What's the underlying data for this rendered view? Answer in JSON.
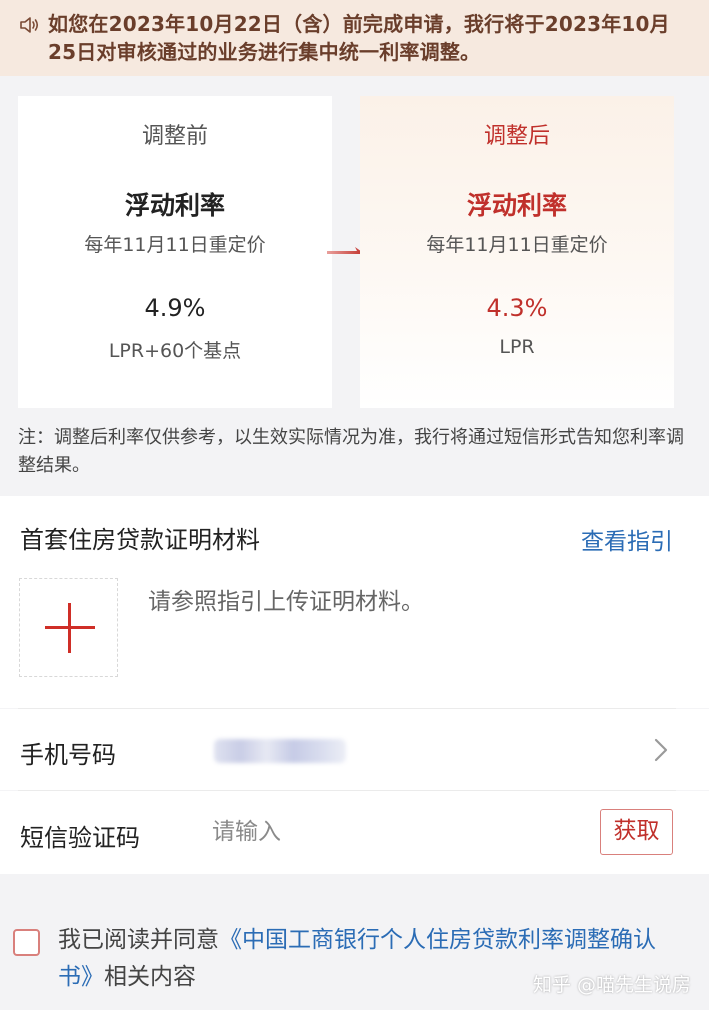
{
  "notice": {
    "text": "如您在2023年10月22日（含）前完成申请，我行将于2023年10月25日对审核通过的业务进行集中统一利率调整。"
  },
  "compare": {
    "before": {
      "head": "调整前",
      "type": "浮动利率",
      "reprice": "每年11月11日重定价",
      "rate": "4.9%",
      "basis": "LPR+60个基点"
    },
    "after": {
      "head": "调整后",
      "type": "浮动利率",
      "reprice": "每年11月11日重定价",
      "rate": "4.3%",
      "basis": "LPR"
    },
    "note": "注：调整后利率仅供参考，以生效实际情况为准，我行将通过短信形式告知您利率调整结果。"
  },
  "proof": {
    "title": "首套住房贷款证明材料",
    "guide_link": "查看指引",
    "hint": "请参照指引上传证明材料。"
  },
  "form": {
    "phone_label": "手机号码",
    "sms_label": "短信验证码",
    "sms_placeholder": "请输入",
    "get_code": "获取"
  },
  "agreement": {
    "prefix": "我已阅读并同意",
    "link": "《中国工商银行个人住房贷款利率调整确认书》",
    "suffix": "相关内容"
  },
  "watermark": "知乎 @喵先生说房",
  "colors": {
    "accent_red": "#c0302b",
    "link_blue": "#2b6cb5",
    "notice_bg": "#f6e9df"
  }
}
